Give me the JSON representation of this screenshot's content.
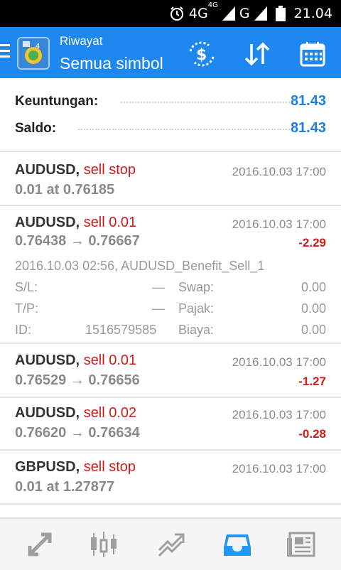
{
  "status_bar": {
    "network1": "4G",
    "network1_sup": "4G",
    "network2": "G",
    "time": "21.04"
  },
  "header": {
    "subtitle": "Riwayat",
    "title": "Semua simbol"
  },
  "summary": {
    "profit_label": "Keuntungan:",
    "profit_value": "81.43",
    "balance_label": "Saldo:",
    "balance_value": "81.43"
  },
  "orders": [
    {
      "symbol": "AUDUSD,",
      "type": "sell stop",
      "line2": "0.01 at 0.76185",
      "time": "2016.10.03 17:00",
      "profit": ""
    },
    {
      "symbol": "AUDUSD,",
      "type": "sell 0.01",
      "line2": "0.76438 → 0.76667",
      "time": "2016.10.03 17:00",
      "profit": "-2.29",
      "details": {
        "comment": "2016.10.03 02:56, AUDUSD_Benefit_Sell_1",
        "sl_label": "S/L:",
        "sl_value": "—",
        "swap_label": "Swap:",
        "swap_value": "0.00",
        "tp_label": "T/P:",
        "tp_value": "—",
        "tax_label": "Pajak:",
        "tax_value": "0.00",
        "id_label": "ID:",
        "id_value": "1516579585",
        "fee_label": "Biaya:",
        "fee_value": "0.00"
      }
    },
    {
      "symbol": "AUDUSD,",
      "type": "sell 0.01",
      "line2": "0.76529 → 0.76656",
      "time": "2016.10.03 17:00",
      "profit": "-1.27"
    },
    {
      "symbol": "AUDUSD,",
      "type": "sell 0.02",
      "line2": "0.76620 → 0.76634",
      "time": "2016.10.03 17:00",
      "profit": "-0.28"
    },
    {
      "symbol": "GBPUSD,",
      "type": "sell stop",
      "line2": "0.01 at 1.27877",
      "time": "2016.10.03 17:00",
      "profit": ""
    }
  ],
  "bottom_nav": [
    "quotes-icon",
    "chart-icon",
    "trade-icon",
    "history-icon",
    "news-icon"
  ],
  "colors": {
    "appbar": "#1e88f0",
    "accent_value": "#1e7fe0",
    "sell": "#d11b1b",
    "nav_active": "#2196f3",
    "nav_inactive": "#9e9e9e"
  }
}
